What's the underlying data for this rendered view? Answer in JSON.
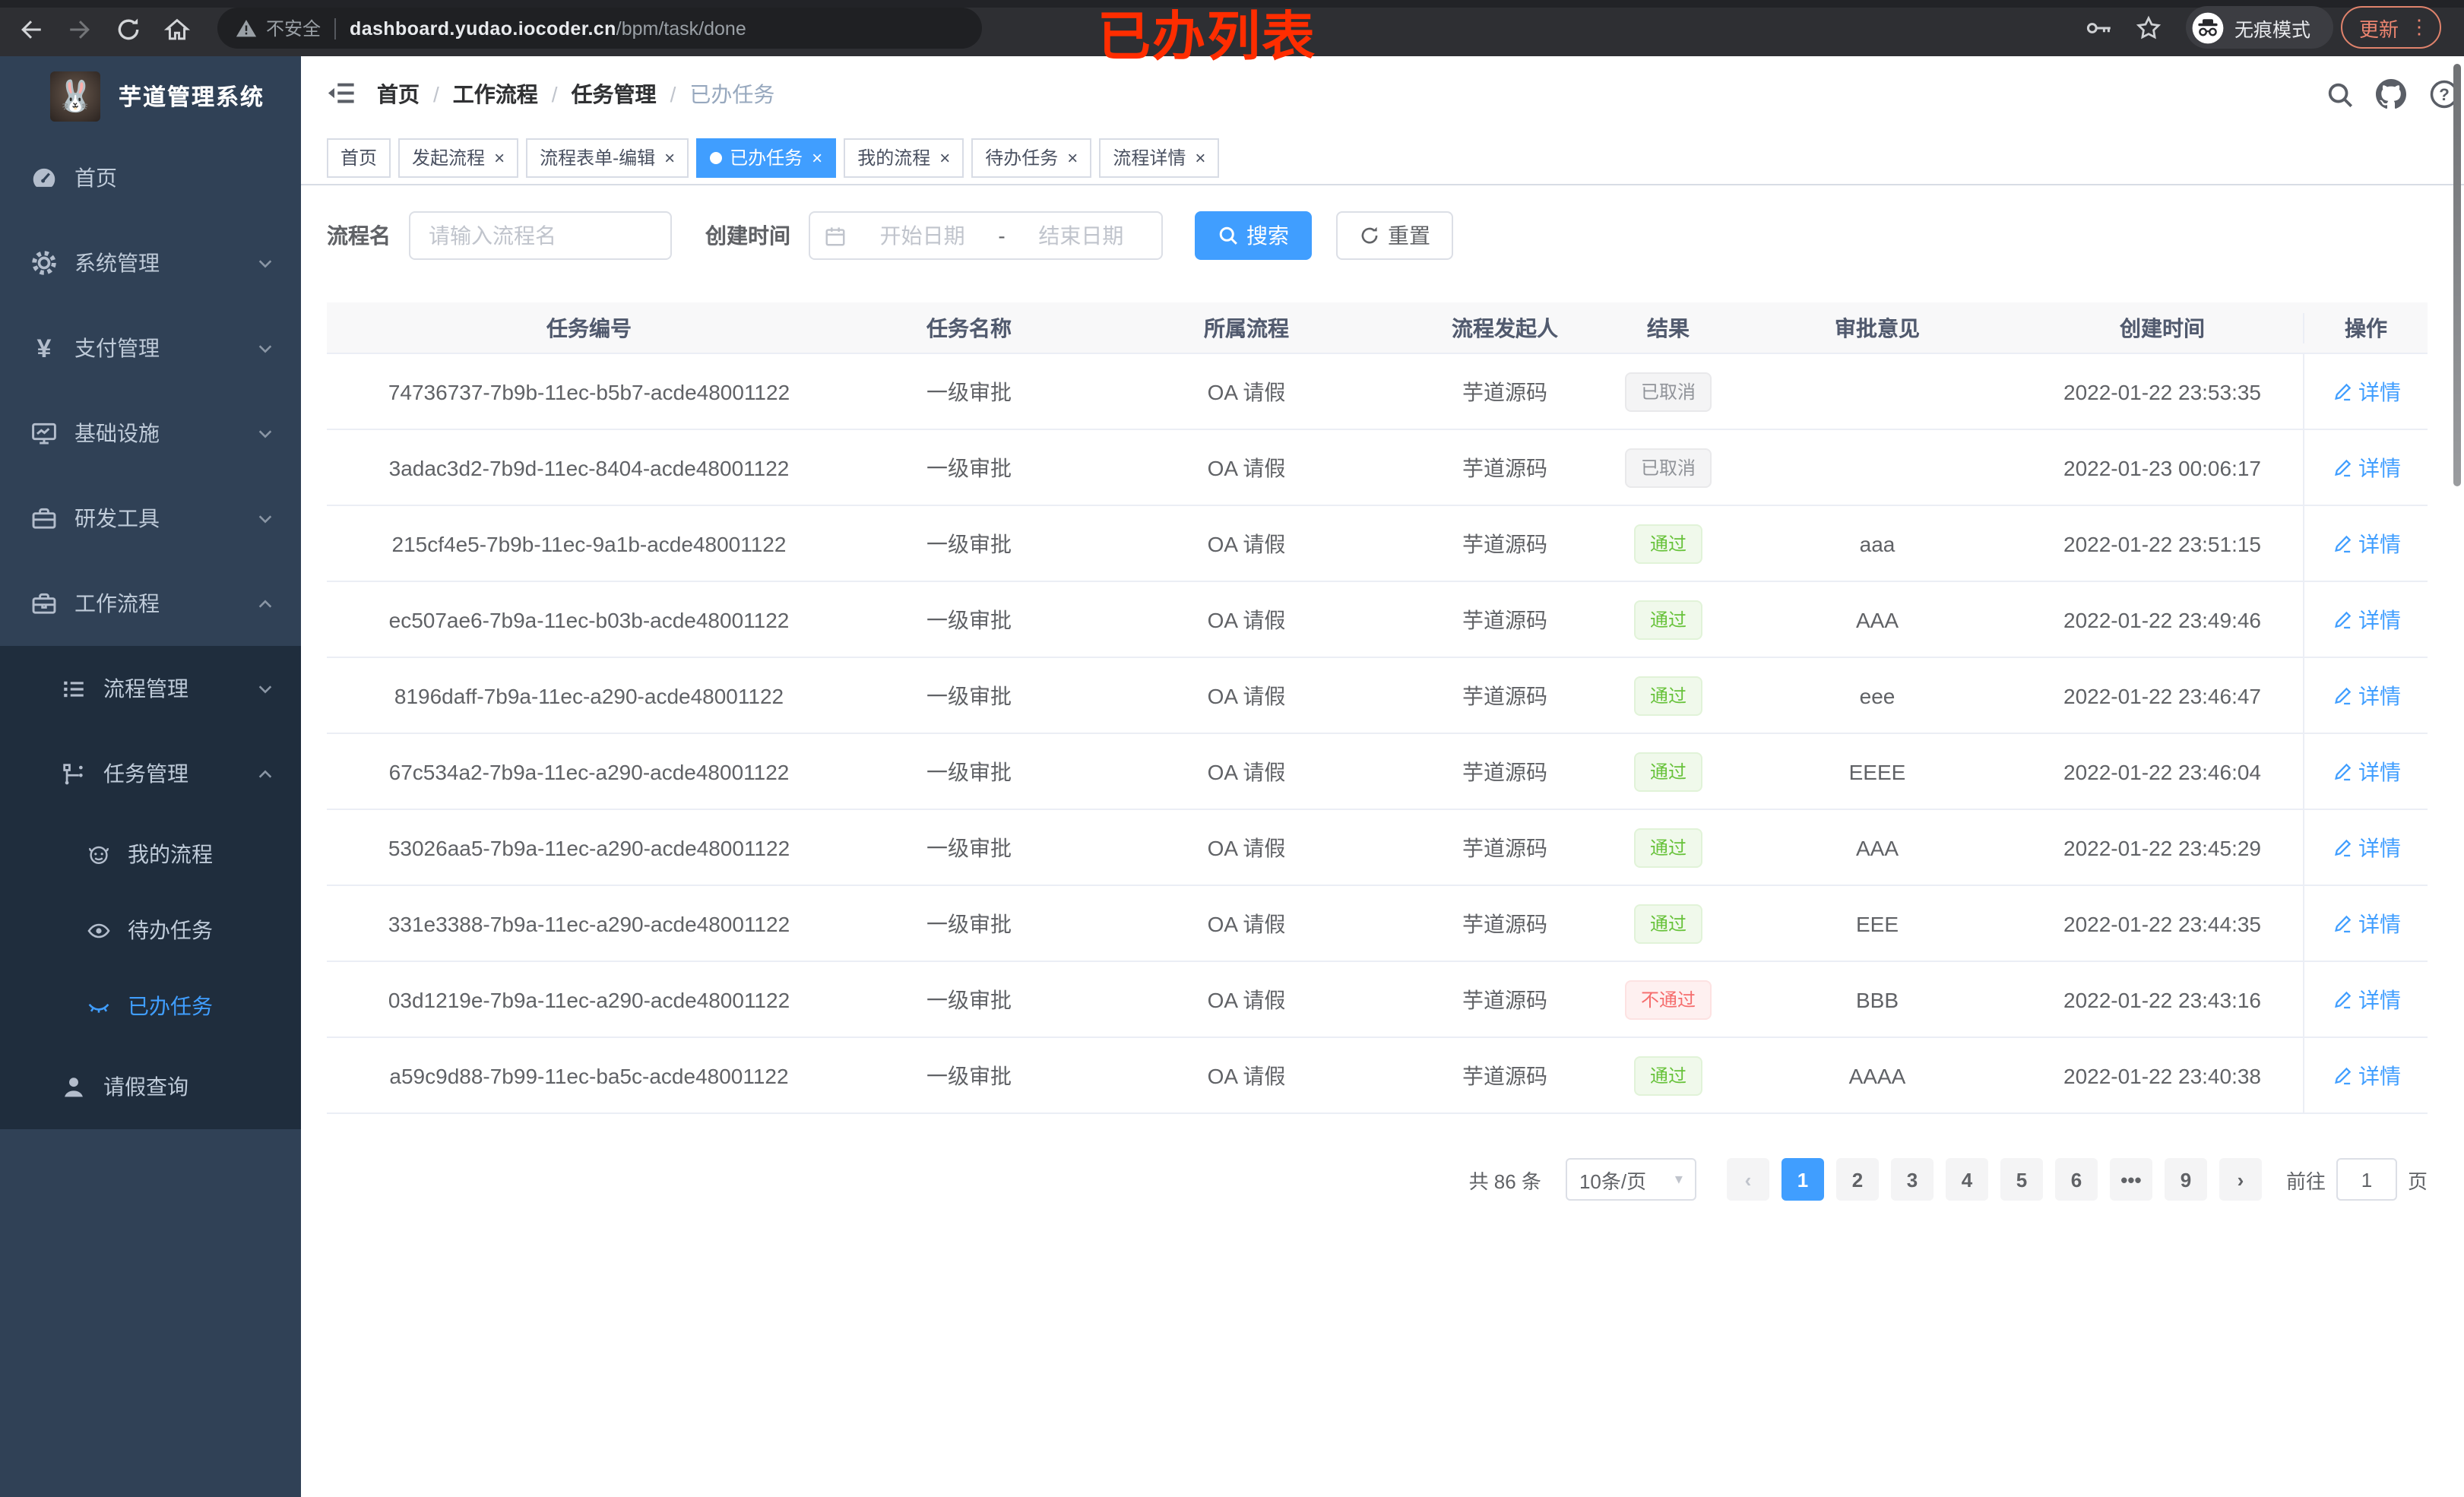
{
  "browser": {
    "tab_overlay_title": "已办列表",
    "security_label": "不安全",
    "url_domain": "dashboard.yudao.iocoder.cn",
    "url_path": "/bpm/task/done",
    "incognito_label": "无痕模式",
    "update_label": "更新"
  },
  "sidebar": {
    "logo_title": "芋道管理系统",
    "menu": [
      {
        "label": "首页",
        "icon": "dashboard-icon",
        "level": 1
      },
      {
        "label": "系统管理",
        "icon": "gear-icon",
        "level": 1,
        "chevron": "down"
      },
      {
        "label": "支付管理",
        "icon": "yen-icon",
        "level": 1,
        "chevron": "down"
      },
      {
        "label": "基础设施",
        "icon": "monitor-icon",
        "level": 1,
        "chevron": "down"
      },
      {
        "label": "研发工具",
        "icon": "toolbox-icon",
        "level": 1,
        "chevron": "down"
      },
      {
        "label": "工作流程",
        "icon": "briefcase-icon",
        "level": 1,
        "chevron": "up"
      }
    ],
    "submenu": [
      {
        "label": "流程管理",
        "icon": "list-icon",
        "level": 2,
        "chevron": "down"
      },
      {
        "label": "任务管理",
        "icon": "flow-icon",
        "level": 2,
        "chevron": "up"
      },
      {
        "label": "我的流程",
        "icon": "robot-icon",
        "level": 3
      },
      {
        "label": "待办任务",
        "icon": "eye-icon",
        "level": 3
      },
      {
        "label": "已办任务",
        "icon": "eye-closed-icon",
        "level": 3,
        "active": true
      },
      {
        "label": "请假查询",
        "icon": "user-icon",
        "level": 2
      }
    ]
  },
  "header": {
    "breadcrumb": [
      "首页",
      "工作流程",
      "任务管理",
      "已办任务"
    ]
  },
  "tabs": [
    {
      "label": "首页",
      "closable": false,
      "active": false
    },
    {
      "label": "发起流程",
      "closable": true,
      "active": false
    },
    {
      "label": "流程表单-编辑",
      "closable": true,
      "active": false
    },
    {
      "label": "已办任务",
      "closable": true,
      "active": true
    },
    {
      "label": "我的流程",
      "closable": true,
      "active": false
    },
    {
      "label": "待办任务",
      "closable": true,
      "active": false
    },
    {
      "label": "流程详情",
      "closable": true,
      "active": false
    }
  ],
  "filters": {
    "name_label": "流程名",
    "name_placeholder": "请输入流程名",
    "time_label": "创建时间",
    "start_placeholder": "开始日期",
    "range_separator": "-",
    "end_placeholder": "结束日期",
    "search_label": "搜索",
    "reset_label": "重置"
  },
  "table": {
    "columns": [
      "任务编号",
      "任务名称",
      "所属流程",
      "流程发起人",
      "结果",
      "审批意见",
      "创建时间",
      "操作"
    ],
    "action_label": "详情",
    "rows": [
      {
        "id": "74736737-7b9b-11ec-b5b7-acde48001122",
        "name": "一级审批",
        "process": "OA 请假",
        "starter": "芋道源码",
        "result": "已取消",
        "result_type": "info",
        "comment": "",
        "created": "2022-01-22 23:53:35"
      },
      {
        "id": "3adac3d2-7b9d-11ec-8404-acde48001122",
        "name": "一级审批",
        "process": "OA 请假",
        "starter": "芋道源码",
        "result": "已取消",
        "result_type": "info",
        "comment": "",
        "created": "2022-01-23 00:06:17"
      },
      {
        "id": "215cf4e5-7b9b-11ec-9a1b-acde48001122",
        "name": "一级审批",
        "process": "OA 请假",
        "starter": "芋道源码",
        "result": "通过",
        "result_type": "success",
        "comment": "aaa",
        "created": "2022-01-22 23:51:15"
      },
      {
        "id": "ec507ae6-7b9a-11ec-b03b-acde48001122",
        "name": "一级审批",
        "process": "OA 请假",
        "starter": "芋道源码",
        "result": "通过",
        "result_type": "success",
        "comment": "AAA",
        "created": "2022-01-22 23:49:46"
      },
      {
        "id": "8196daff-7b9a-11ec-a290-acde48001122",
        "name": "一级审批",
        "process": "OA 请假",
        "starter": "芋道源码",
        "result": "通过",
        "result_type": "success",
        "comment": "eee",
        "created": "2022-01-22 23:46:47"
      },
      {
        "id": "67c534a2-7b9a-11ec-a290-acde48001122",
        "name": "一级审批",
        "process": "OA 请假",
        "starter": "芋道源码",
        "result": "通过",
        "result_type": "success",
        "comment": "EEEE",
        "created": "2022-01-22 23:46:04"
      },
      {
        "id": "53026aa5-7b9a-11ec-a290-acde48001122",
        "name": "一级审批",
        "process": "OA 请假",
        "starter": "芋道源码",
        "result": "通过",
        "result_type": "success",
        "comment": "AAA",
        "created": "2022-01-22 23:45:29"
      },
      {
        "id": "331e3388-7b9a-11ec-a290-acde48001122",
        "name": "一级审批",
        "process": "OA 请假",
        "starter": "芋道源码",
        "result": "通过",
        "result_type": "success",
        "comment": "EEE",
        "created": "2022-01-22 23:44:35"
      },
      {
        "id": "03d1219e-7b9a-11ec-a290-acde48001122",
        "name": "一级审批",
        "process": "OA 请假",
        "starter": "芋道源码",
        "result": "不通过",
        "result_type": "danger",
        "comment": "BBB",
        "created": "2022-01-22 23:43:16"
      },
      {
        "id": "a59c9d88-7b99-11ec-ba5c-acde48001122",
        "name": "一级审批",
        "process": "OA 请假",
        "starter": "芋道源码",
        "result": "通过",
        "result_type": "success",
        "comment": "AAAA",
        "created": "2022-01-22 23:40:38"
      }
    ]
  },
  "pagination": {
    "total_label": "共 86 条",
    "page_size": "10条/页",
    "prev_label": "‹",
    "next_label": "›",
    "pages": [
      "1",
      "2",
      "3",
      "4",
      "5",
      "6",
      "•••",
      "9"
    ],
    "active_page": "1",
    "goto_label": "前往",
    "goto_value": "1",
    "page_label": "页"
  },
  "colors": {
    "accent": "#409EFF",
    "success": "#67C23A",
    "danger": "#F56C6C",
    "info": "#909399",
    "sidebar_bg": "#304156",
    "submenu_bg": "#1F2D3D",
    "annotation_red": "#FF2D00"
  }
}
